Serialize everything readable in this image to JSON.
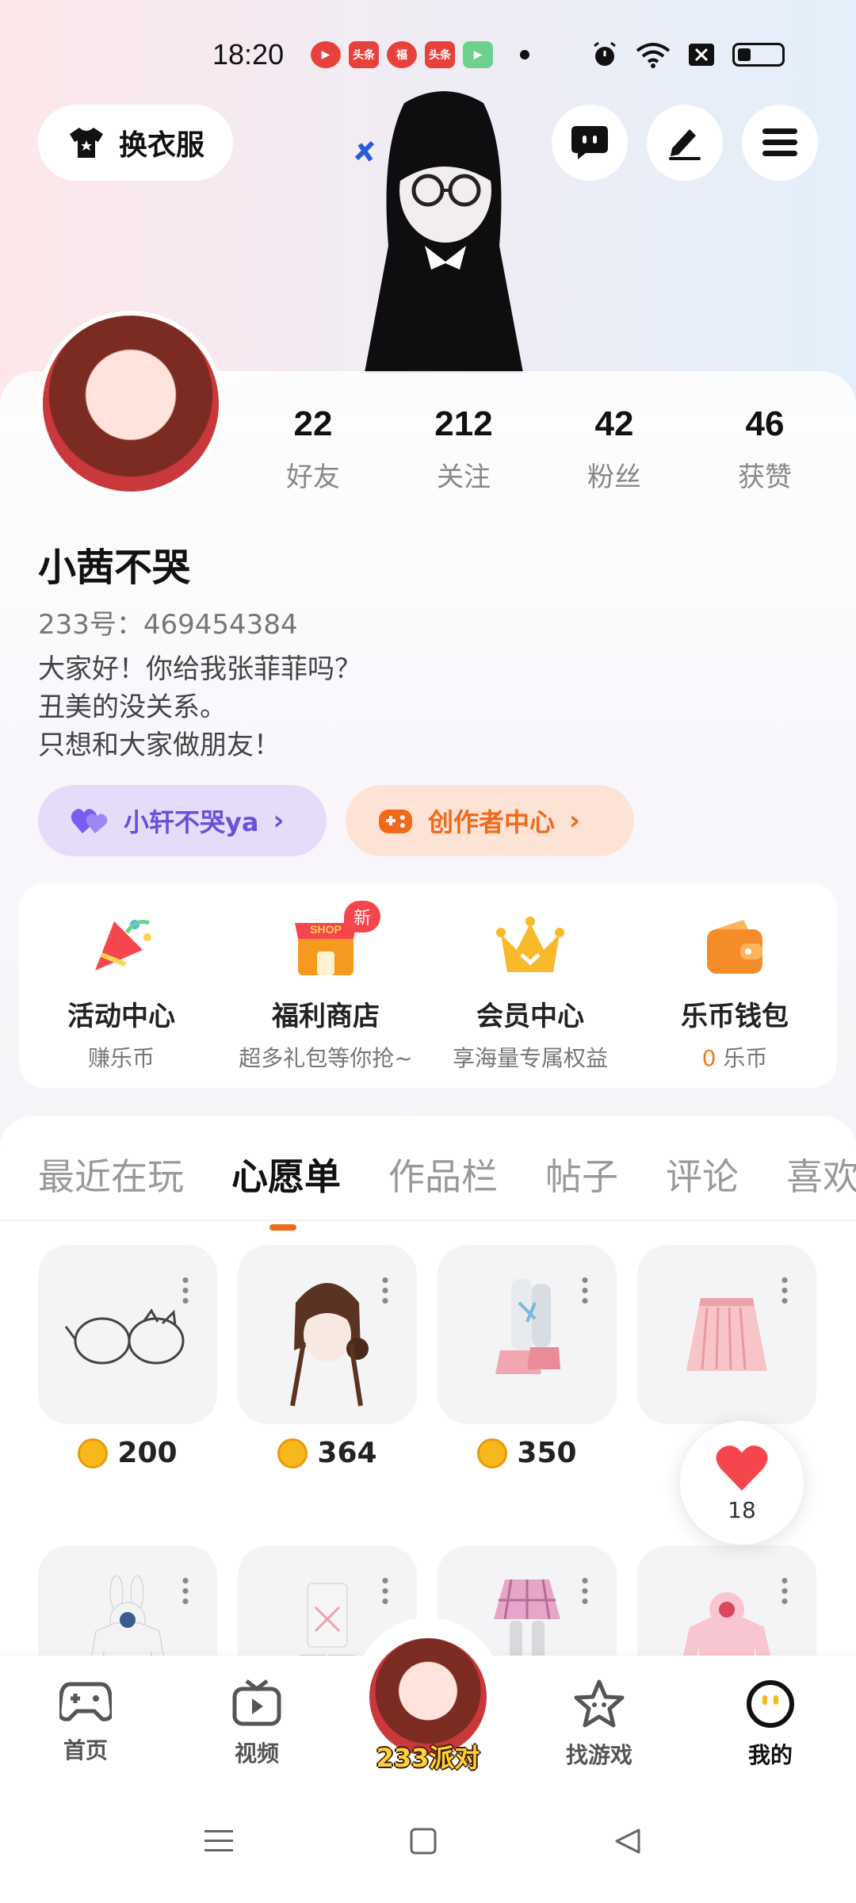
{
  "status_bar": {
    "time": "18:20",
    "apps": [
      {
        "icon": "video-app-icon",
        "label": "▶",
        "color": "#e8413b"
      },
      {
        "icon": "toutiao-app-icon",
        "label": "头条",
        "color": "#e8413b"
      },
      {
        "icon": "gift-app-icon",
        "label": "福",
        "color": "#e8413b"
      },
      {
        "icon": "toutiao-app-icon",
        "label": "头条",
        "color": "#e8413b"
      },
      {
        "icon": "play-app-icon",
        "label": "▶",
        "color": "#6cd18e"
      }
    ]
  },
  "header": {
    "outfit_label": "换衣服"
  },
  "profile": {
    "stats": [
      {
        "value": "22",
        "label": "好友"
      },
      {
        "value": "212",
        "label": "关注"
      },
      {
        "value": "42",
        "label": "粉丝"
      },
      {
        "value": "46",
        "label": "获赞"
      }
    ],
    "nickname": "小茜不哭",
    "user_id": "233号：469454384",
    "bio": [
      "大家好！你给我张菲菲吗？",
      "丑美的没关系。",
      "只想和大家做朋友！"
    ],
    "partner_label": "小轩不哭ya",
    "creator_label": "创作者中心"
  },
  "services": [
    {
      "icon": "party-popper-icon",
      "title": "活动中心",
      "subtitle": "赚乐币"
    },
    {
      "icon": "shop-icon",
      "title": "福利商店",
      "subtitle": "超多礼包等你抢~",
      "badge": "新"
    },
    {
      "icon": "crown-icon",
      "title": "会员中心",
      "subtitle": "享海量专属权益"
    },
    {
      "icon": "wallet-icon",
      "title": "乐币钱包",
      "subtitle_value": "0",
      "subtitle": "乐币"
    }
  ],
  "tabs": [
    "最近在玩",
    "心愿单",
    "作品栏",
    "帖子",
    "评论",
    "喜欢"
  ],
  "active_tab": "心愿单",
  "wishlist": [
    {
      "icon": "glasses-icon",
      "price": "200"
    },
    {
      "icon": "hair-icon",
      "price": "364"
    },
    {
      "icon": "boots-icon",
      "price": "350"
    },
    {
      "icon": "skirt-icon",
      "price": ""
    },
    {
      "icon": "bunny-hoodie-icon",
      "price": ""
    },
    {
      "icon": "outfit-icon",
      "price": ""
    },
    {
      "icon": "plaid-skirt-icon",
      "price": ""
    },
    {
      "icon": "pink-hoodie-icon",
      "price": ""
    }
  ],
  "like_fab": {
    "count": "18"
  },
  "bottom_nav": [
    {
      "icon": "gamepad-icon",
      "label": "首页"
    },
    {
      "icon": "tv-icon",
      "label": "视频"
    },
    {
      "icon": "party-avatar-icon",
      "label": "233派对"
    },
    {
      "icon": "star-game-icon",
      "label": "找游戏"
    },
    {
      "icon": "face-icon",
      "label": "我的"
    }
  ],
  "colors": {
    "accent_orange": "#f06a1a",
    "accent_purple": "#6a52d8",
    "coin": "#f6b81b",
    "heart": "#f5464e"
  }
}
